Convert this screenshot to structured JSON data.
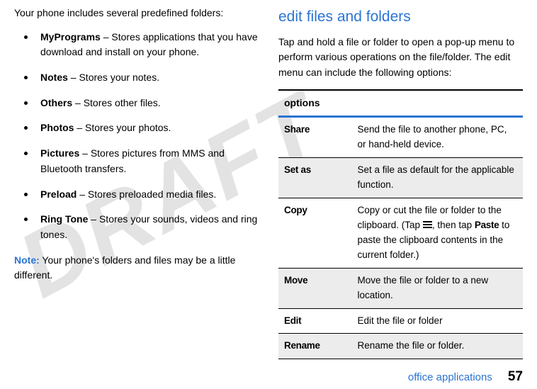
{
  "watermark": "DRAFT",
  "left": {
    "intro": "Your phone includes several predefined folders:",
    "bullets": [
      {
        "name": "MyPrograms",
        "desc": " – Stores applications that you have download and install on your phone."
      },
      {
        "name": "Notes",
        "desc": " – Stores your notes."
      },
      {
        "name": "Others",
        "desc": " – Stores other files."
      },
      {
        "name": "Photos",
        "desc": " – Stores your photos."
      },
      {
        "name": "Pictures",
        "desc": " – Stores pictures from MMS and Bluetooth transfers."
      },
      {
        "name": "Preload",
        "desc": " – Stores preloaded media files."
      },
      {
        "name": "Ring Tone",
        "desc": " – Stores your sounds, videos and ring tones."
      }
    ],
    "noteLabel": "Note:",
    "noteText": " Your phone's folders and files may be a little different."
  },
  "right": {
    "heading": "edit files and folders",
    "para": "Tap and hold a file or folder to open a pop-up menu to perform various operations on the file/folder. The edit menu can include the following options:",
    "tableHeader": "options",
    "rows": [
      {
        "name": "Share",
        "desc": "Send the file to another phone, PC, or hand-held device."
      },
      {
        "name": "Set as",
        "desc": " Set a file as default for the applicable function."
      },
      {
        "name": "Copy",
        "descPre": "Copy or cut the file or folder to the clipboard. (Tap ",
        "descMid": ", then tap ",
        "paste": "Paste",
        "descPost": " to paste the clipboard contents in the current folder.)"
      },
      {
        "name": "Move",
        "desc": "Move the file or folder to a new location."
      },
      {
        "name": "Edit",
        "desc": "Edit the file or folder"
      },
      {
        "name": "Rename",
        "desc": "Rename the file or folder."
      }
    ]
  },
  "footer": {
    "section": "office applications",
    "page": "57"
  }
}
